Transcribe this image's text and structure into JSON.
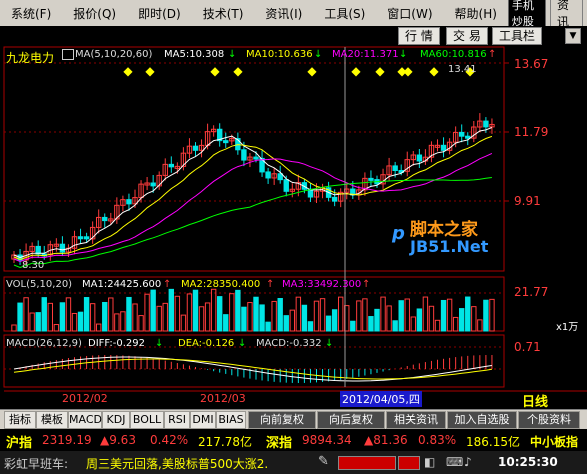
{
  "menu": {
    "items": [
      "系统(F)",
      "报价(Q)",
      "即时(D)",
      "技术(T)",
      "资讯(I)",
      "工具(S)",
      "窗口(W)",
      "帮助(H)"
    ],
    "phone_label": "手机炒股",
    "info_label": "资 讯"
  },
  "toolbar": {
    "row": "行 情",
    "trade": "交 易",
    "tools": "工具栏"
  },
  "stock": {
    "name": "九龙电力",
    "ma_label": "MA(5,10,20,60)",
    "ma5": "MA5:10.308",
    "ma10": "MA10:10.636",
    "ma20": "MA20:11.371",
    "ma60": "MA60:10.816",
    "high_label": "13.41",
    "low_label": "8.30",
    "watermark_cn": "脚本之家",
    "watermark_en": "JB51.Net",
    "date_cursor": "2012/04/05,四",
    "period_label": "日线",
    "volume_unit": "x1万",
    "colors": {
      "up": "#ff3c3c",
      "down": "#00e5e5",
      "ma5": "#ffffff",
      "ma10": "#ffff00",
      "ma20": "#ff00ff",
      "ma60": "#00ff00"
    }
  },
  "price_axis": [
    "13.67",
    "11.79",
    "9.91"
  ],
  "volume": {
    "label": "VOL(5,10,20)",
    "ma1": "MA1:24425.600",
    "ma2": "MA2:28350.400",
    "ma3": "MA3:33492.300",
    "axis_top": "21.77"
  },
  "macd": {
    "label": "MACD(26,12,9)",
    "diff": "DIFF:-0.292",
    "dea": "DEA:-0.126",
    "macd": "MACD:-0.332",
    "axis_top": "0.71"
  },
  "x_dates": [
    "2012/02",
    "2012/03"
  ],
  "tabs": [
    "指标",
    "模板",
    "MACD",
    "KDJ",
    "BOLL",
    "RSI",
    "DMI",
    "BIAS",
    "向前复权",
    "向后复权",
    "相关资讯",
    "加入自选股",
    "个股资料"
  ],
  "index_bar": {
    "sh_name": "沪指",
    "sh_value": "2319.19",
    "sh_change": "▲9.63",
    "sh_pct": "0.42%",
    "sh_amount": "217.78亿",
    "sz_name": "深指",
    "sz_value": "9894.34",
    "sz_change": "▲81.36",
    "sz_pct": "0.83%",
    "sz_amount": "186.15亿",
    "small_board": "中小板指"
  },
  "status": {
    "news_label": "彩虹早班车:",
    "news_text": "周三美元回落,美股标普500大涨2.",
    "time": "10:25:30"
  }
}
